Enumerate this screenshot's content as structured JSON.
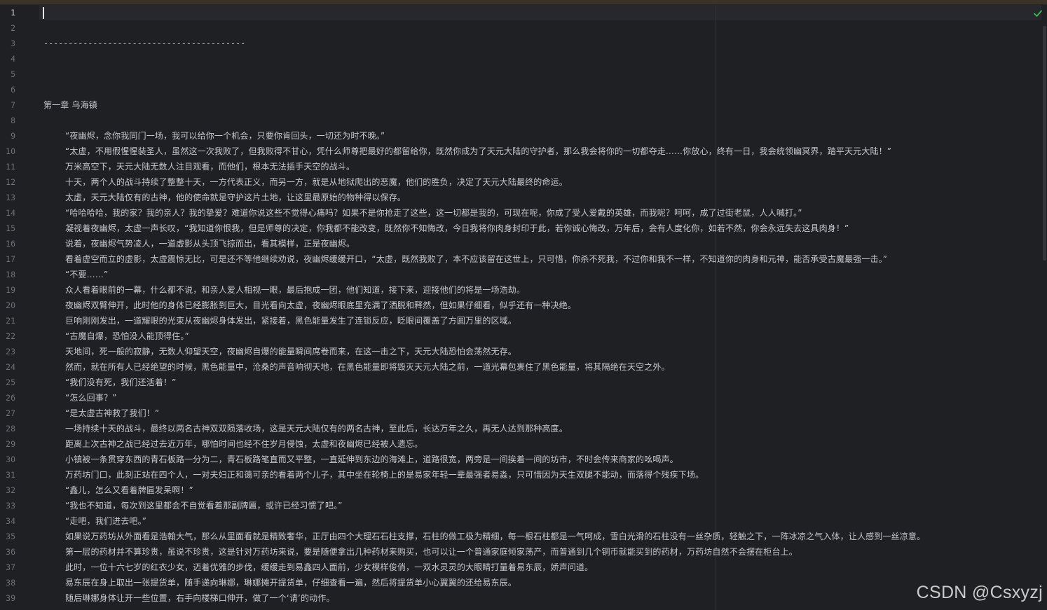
{
  "editor": {
    "lines": [
      {
        "n": "1",
        "t": ""
      },
      {
        "n": "2",
        "t": ""
      },
      {
        "n": "3",
        "t": "-----------------------------------------"
      },
      {
        "n": "4",
        "t": ""
      },
      {
        "n": "5",
        "t": ""
      },
      {
        "n": "6",
        "t": ""
      },
      {
        "n": "7",
        "t": "第一章 乌海镇"
      },
      {
        "n": "8",
        "t": ""
      },
      {
        "n": "9",
        "t": "“夜幽烬，念你我同门一场，我可以给你一个机会，只要你肯回头，一切还为时不晚。”"
      },
      {
        "n": "10",
        "t": "“太虚，不用假惺惺装圣人，虽然这一次我败了，但我败得不甘心，凭什么师尊把最好的都留给你，既然你成为了天元大陆的守护者，那么我会将你的一切都夺走……你放心，终有一日，我会统领幽冥界，踏平天元大陆！”"
      },
      {
        "n": "11",
        "t": "万米高空下，天元大陆无数人注目观看，而他们，根本无法插手天空的战斗。"
      },
      {
        "n": "12",
        "t": "十天，两个人的战斗持续了整整十天，一方代表正义，而另一方，就是从地狱爬出的恶魔，他们的胜负，决定了天元大陆最终的命运。"
      },
      {
        "n": "13",
        "t": "太虚，天元大陆仅有的古神，他的使命就是守护这片土地，让这里最原始的物种得以保存。"
      },
      {
        "n": "14",
        "t": "“哈哈哈哈，我的家？我的亲人？我的挚爱？难道你说这些不觉得心痛吗？如果不是你抢走了这些，这一切都是我的，可现在呢，你成了受人爱戴的英雄，而我呢？呵呵，成了过街老鼠，人人喊打。”"
      },
      {
        "n": "15",
        "t": "凝视着夜幽烬，太虚一声长叹，“我知道你恨我，但是师尊的决定，你我都不能改变，既然你不知悔改，今日我将你肉身封印于此，若你诚心悔改，万年后，会有人度化你，如若不然，你会永远失去这具肉身！”"
      },
      {
        "n": "16",
        "t": "说着，夜幽烬气势凌人，一道虚影从头顶飞掠而出，看其模样，正是夜幽烬。"
      },
      {
        "n": "17",
        "t": "看着虚空而立的虚影，太虚震惊无比，可是还不等他继续劝说，夜幽烬缓缓开口，“太虚，既然我败了，本不应该留在这世上，只可惜，你杀不死我，不过你和我不一样，不知道你的肉身和元神，能否承受古魔最强一击。”"
      },
      {
        "n": "18",
        "t": "“不要……”"
      },
      {
        "n": "19",
        "t": "众人看着眼前的一幕，什么都不说，和亲人爱人相视一眼，最后抱成一团，他们知道，接下来，迎接他们的将是一场浩劫。"
      },
      {
        "n": "20",
        "t": "夜幽烬双臂伸开，此时他的身体已经膨胀到巨大，目光看向太虚，夜幽烬眼底里充满了洒脱和释然，但如果仔细看，似乎还有一种决绝。"
      },
      {
        "n": "21",
        "t": "巨响刚刚发出，一道耀眼的光束从夜幽烬身体发出，紧接着，黑色能量发生了连锁反应，眨眼间覆盖了方圆万里的区域。"
      },
      {
        "n": "22",
        "t": "“古魔自爆，恐怕没人能顶得住。”"
      },
      {
        "n": "23",
        "t": "天地间，死一般的寂静，无数人仰望天空，夜幽烬自爆的能量瞬间席卷而来，在这一击之下，天元大陆恐怕会荡然无存。"
      },
      {
        "n": "24",
        "t": "然而，就在所有人已经绝望的时候，黑色能量中，沧桑的声音响彻天地，在黑色能量即将毁灭天元大陆之前，一道光幕包裹住了黑色能量，将其隔绝在天空之外。"
      },
      {
        "n": "25",
        "t": "“我们没有死，我们还活着！”"
      },
      {
        "n": "26",
        "t": "“怎么回事？”"
      },
      {
        "n": "27",
        "t": "“是太虚古神救了我们！”"
      },
      {
        "n": "28",
        "t": "一场持续十天的战斗，最终以两名古神双双陨落收场，这是天元大陆仅有的两名古神，至此后，长达万年之久，再无人达到那种高度。"
      },
      {
        "n": "29",
        "t": "距离上次古神之战已经过去近万年，哪怕时间也经不住岁月侵蚀，太虚和夜幽烬已经被人遗忘。"
      },
      {
        "n": "30",
        "t": "小镇被一条贯穿东西的青石板路一分为二，青石板路笔直而又平整，一直延伸到东边的海滩上，道路很宽，两旁是一间挨着一间的坊市，不时会传来商家的吆喝声。"
      },
      {
        "n": "31",
        "t": "万药坊门口，此刻正站在四个人，一对夫妇正和蔼可亲的看着两个儿子，其中坐在轮椅上的是易家年轻一辈最强者易淼，只可惜因为天生双腿不能动，而落得个残疾下场。"
      },
      {
        "n": "32",
        "t": "“鑫儿，怎么又看着牌匾发呆啊！”"
      },
      {
        "n": "33",
        "t": "“我也不知道，每次到这里都会不自觉看着那副牌匾，或许已经习惯了吧。”"
      },
      {
        "n": "34",
        "t": "“走吧，我们进去吧。”"
      },
      {
        "n": "35",
        "t": "如果说万药坊从外面看是浩翰大气，那么从里面看就是精致奢华，正厅由四个大理石石柱支撑，石柱的做工极为精细，每一根石柱都是一气呵成，雪白光滑的石柱没有一丝杂质，轻触之下，一阵冰凉之气入体，让人感到一丝凉意。"
      },
      {
        "n": "36",
        "t": "第一层的药材并不算珍贵，虽说不珍贵，这是针对万药坊来说，要是随便拿出几种药材来购买，也可以让一个普通家庭倾家荡产，而普通到几个铜币就能买到的药材，万药坊自然不会摆在柜台上。"
      },
      {
        "n": "37",
        "t": "此时，一位十六七岁的红衣少女，迈着优雅的步伐，缓缓走到易鑫四人面前，少女模样俊俏，一双水灵灵的大眼睛打量着易东辰，娇声问道。"
      },
      {
        "n": "38",
        "t": "易东辰在身上取出一张提货单，随手递向琳娜，琳娜摊开提货单，仔细查看一遍，然后将提货单小心翼翼的还给易东辰。"
      },
      {
        "n": "39",
        "t": "随后琳娜身体让开一些位置，右手向楼梯口伸开，做了一个‘请’的动作。"
      }
    ],
    "cursor_line": "1"
  },
  "watermark": "CSDN @Csxyzj",
  "status_icon": "check-icon",
  "colors": {
    "background": "#1f2023",
    "text": "#c5c8ce",
    "line_number": "#6d7076",
    "check": "#3fb950"
  }
}
